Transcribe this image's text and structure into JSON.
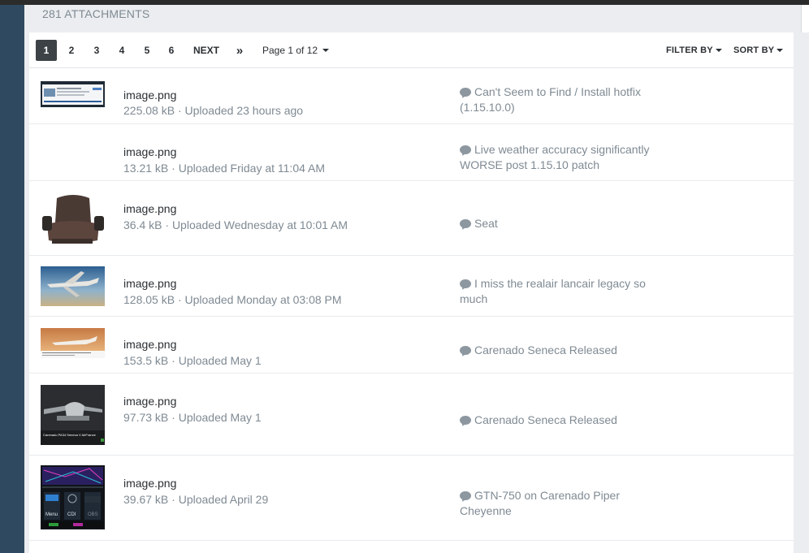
{
  "panel": {
    "title": "281 ATTACHMENTS"
  },
  "pagination": {
    "pages": [
      "1",
      "2",
      "3",
      "4",
      "5",
      "6"
    ],
    "active_page": "1",
    "next_label": "NEXT",
    "last_label": "»",
    "page_select_label": "Page 1 of 12"
  },
  "toolbar": {
    "filter_label": "FILTER BY",
    "sort_label": "SORT BY"
  },
  "attachments": [
    {
      "name": "image.png",
      "size": "225.08 kB",
      "uploaded": "Uploaded 23 hours ago",
      "topic": "Can't Seem to Find / Install hotfix (1.15.10.0)"
    },
    {
      "name": "image.png",
      "size": "13.21 kB",
      "uploaded": "Uploaded Friday at 11:04 AM",
      "topic": "Live weather accuracy significantly WORSE post 1.15.10 patch"
    },
    {
      "name": "image.png",
      "size": "36.4 kB",
      "uploaded": "Uploaded Wednesday at 10:01 AM",
      "topic": "Seat"
    },
    {
      "name": "image.png",
      "size": "128.05 kB",
      "uploaded": "Uploaded Monday at 03:08 PM",
      "topic": "I miss the realair lancair legacy so much"
    },
    {
      "name": "image.png",
      "size": "153.5 kB",
      "uploaded": "Uploaded May 1",
      "topic": "Carenado Seneca Released"
    },
    {
      "name": "image.png",
      "size": "97.73 kB",
      "uploaded": "Uploaded May 1",
      "topic": "Carenado Seneca Released",
      "thumb_caption": "Carenado PA34 Seneca V AirFrance"
    },
    {
      "name": "image.png",
      "size": "39.67 kB",
      "uploaded": "Uploaded April 29",
      "topic": "GTN-750 on Carenado Piper Cheyenne",
      "thumb_labels": {
        "menu": "Menu",
        "cdi": "CDI",
        "obs": "OBS"
      }
    }
  ],
  "icons": {
    "topic": "comment-bubble-icon",
    "dropdown": "caret-down-icon"
  },
  "colors": {
    "sidebar": "#2f4a60",
    "active_page": "#3d4246",
    "muted_text": "#7f8a93"
  }
}
